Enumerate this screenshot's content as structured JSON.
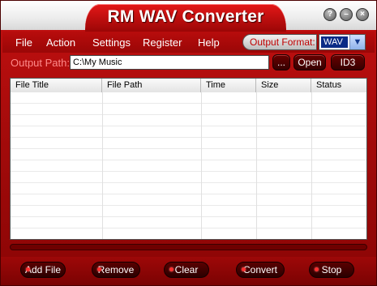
{
  "window": {
    "title": "RM WAV Converter",
    "controls": {
      "help": "?",
      "minimize": "–",
      "close": "×"
    }
  },
  "menu": {
    "items": [
      "File",
      "Action",
      "Settings",
      "Register",
      "Help"
    ],
    "output_format_label": "Output Format:",
    "output_format_value": "WAV"
  },
  "output": {
    "label": "Output Path:",
    "path": "C:\\My Music",
    "browse_label": "...",
    "open_label": "Open",
    "id3_label": "ID3"
  },
  "table": {
    "columns": [
      "File Title",
      "File Path",
      "Time",
      "Size",
      "Status"
    ],
    "rows": []
  },
  "progress": {
    "value": 0
  },
  "buttons": {
    "add_file": "Add File",
    "remove": "Remove",
    "clear": "Clear",
    "convert": "Convert",
    "stop": "Stop"
  },
  "colors": {
    "chrome_red": "#b40c0c",
    "dark_button": "#3a0000",
    "format_highlight": "#0b2c86"
  }
}
